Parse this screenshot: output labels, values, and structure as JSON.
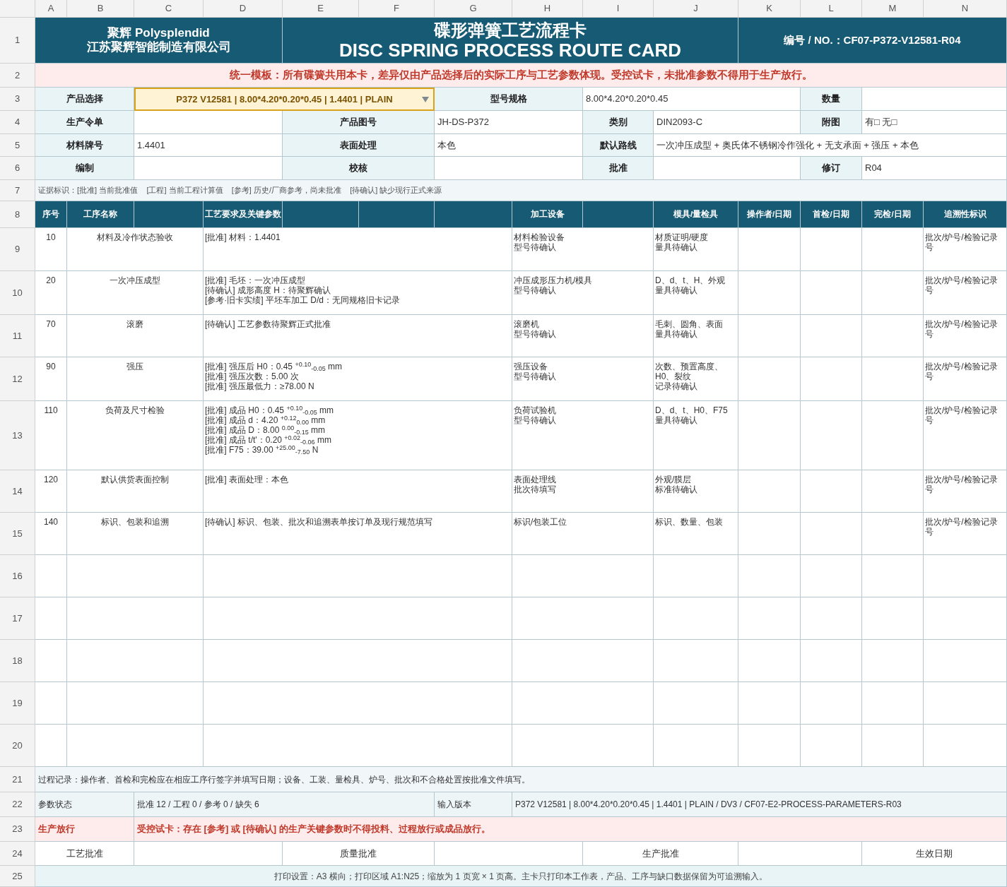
{
  "column_letters": [
    "A",
    "B",
    "C",
    "D",
    "E",
    "F",
    "G",
    "H",
    "I",
    "J",
    "K",
    "L",
    "M",
    "N"
  ],
  "row_numbers": [
    "1",
    "2",
    "3",
    "4",
    "5",
    "6",
    "7",
    "8",
    "9",
    "10",
    "11",
    "12",
    "13",
    "14",
    "15",
    "16",
    "17",
    "18",
    "19",
    "20",
    "21",
    "22",
    "23",
    "24",
    "25"
  ],
  "header": {
    "company": "聚辉 Polysplendid",
    "company_cn": "江苏聚辉智能制造有限公司",
    "title_cn": "碟形弹簧工艺流程卡",
    "title_en": "DISC SPRING PROCESS ROUTE CARD",
    "doc_no": "编号 / NO.：CF07-P372-V12581-R04"
  },
  "notice": "统一模板：所有碟簧共用本卡，差异仅由产品选择后的实际工序与工艺参数体现。受控试卡，未批准参数不得用于生产放行。",
  "product_select": {
    "label": "产品选择",
    "value": "P372 V12581 | 8.00*4.20*0.20*0.45 | 1.4401 | PLAIN"
  },
  "fields": [
    {
      "label": "型号规格",
      "value": "8.00*4.20*0.20*0.45"
    },
    {
      "label": "数量"
    },
    {
      "label": "生产令单"
    },
    {
      "label": "产品图号",
      "value": "JH-DS-P372"
    },
    {
      "label": "类别",
      "value": "DIN2093-C"
    },
    {
      "label": "附图",
      "value": "有□  无□"
    },
    {
      "label": "材料牌号",
      "value": "1.4401"
    },
    {
      "label": "表面处理",
      "value": "本色"
    },
    {
      "label": "默认路线",
      "value": "一次冲压成型 + 奥氏体不锈钢冷作强化 + 无支承面 + 强压 + 本色"
    },
    {
      "label": "编制"
    },
    {
      "label": "校核"
    },
    {
      "label": "批准"
    },
    {
      "label": "修订",
      "value": "R04"
    }
  ],
  "legend": "证据标识：[批准] 当前批准值    [工程] 当前工程计算值    [参考] 历史/厂商参考，尚未批准    [待确认] 缺少现行正式来源",
  "table": {
    "columns": [
      "序号",
      "工序名称",
      "工艺要求及关键参数",
      "加工设备",
      "模具/量检具",
      "操作者/日期",
      "首检/日期",
      "完检/日期",
      "追溯性标识"
    ],
    "rows": [
      {
        "seq": "10",
        "name": "材料及冷作状态验收",
        "params": [
          "[批准] 材料：1.4401"
        ],
        "equipment": [
          "材料检验设备",
          "型号待确认"
        ],
        "tooling": [
          "材质证明/硬度",
          "量具待确认"
        ],
        "trace": "批次/炉号/检验记录号"
      },
      {
        "seq": "20",
        "name": "一次冲压成型",
        "params": [
          "[批准] 毛坯：一次冲压成型",
          "[待确认] 成形高度 H：待聚辉确认",
          "[参考·旧卡实绩] 平坯车加工 D/d：无同规格旧卡记录"
        ],
        "equipment": [
          "冲压成形压力机/模具",
          "型号待确认"
        ],
        "tooling": [
          "D、d、t、H、外观",
          "量具待确认"
        ],
        "trace": "批次/炉号/检验记录号"
      },
      {
        "seq": "70",
        "name": "滚磨",
        "params": [
          "[待确认] 工艺参数待聚辉正式批准"
        ],
        "equipment": [
          "滚磨机",
          "型号待确认"
        ],
        "tooling": [
          "毛刺、圆角、表面",
          "量具待确认"
        ],
        "trace": "批次/炉号/检验记录号"
      },
      {
        "seq": "90",
        "name": "强压",
        "params": [
          "[批准] 强压后 H0：0.45 $^{+0.10}$$_{-0.05}$ mm",
          "[批准] 强压次数：5.00 次",
          "[批准] 强压最低力：≥78.00 N"
        ],
        "equipment": [
          "强压设备",
          "型号待确认"
        ],
        "tooling": [
          "次数、预置高度、H0、裂纹",
          "记录待确认"
        ],
        "trace": "批次/炉号/检验记录号"
      },
      {
        "seq": "110",
        "name": "负荷及尺寸检验",
        "params": [
          "[批准] 成品 H0：0.45 $^{+0.10}$$_{-0.05}$ mm",
          "[批准] 成品 d：4.20 $^{+0.12}$$_{0.00}$ mm",
          "[批准] 成品 D：8.00 $^{0.00}$$_{-0.15}$ mm",
          "[批准] 成品 t/t'：0.20 $^{+0.02}$$_{-0.06}$ mm",
          "[批准] F75：39.00 $^{+25.00}$$_{-7.50}$ N"
        ],
        "equipment": [
          "负荷试验机",
          "型号待确认"
        ],
        "tooling": [
          "D、d、t、H0、F75",
          "量具待确认"
        ],
        "trace": "批次/炉号/检验记录号"
      },
      {
        "seq": "120",
        "name": "默认供货表面控制",
        "params": [
          "[批准] 表面处理：本色"
        ],
        "equipment": [
          "表面处理线",
          "批次待填写"
        ],
        "tooling": [
          "外观/膜层",
          "标准待确认"
        ],
        "trace": "批次/炉号/检验记录号"
      },
      {
        "seq": "140",
        "name": "标识、包装和追溯",
        "params": [
          "[待确认] 标识、包装、批次和追溯表单按订单及现行规范填写"
        ],
        "equipment": [
          "标识/包装工位"
        ],
        "tooling": [
          "标识、数量、包装"
        ],
        "trace": "批次/炉号/检验记录号"
      }
    ]
  },
  "process_note": "过程记录：操作者、首检和完检应在相应工序行签字并填写日期；设备、工装、量检具、炉号、批次和不合格处置按批准文件填写。",
  "param_status": {
    "label": "参数状态",
    "value": "批准 12 / 工程 0 / 参考 0 / 缺失 6"
  },
  "input_version": {
    "label": "输入版本",
    "value": "P372 V12581 | 8.00*4.20*0.20*0.45 | 1.4401 | PLAIN / DV3 / CF07-E2-PROCESS-PARAMETERS-R03"
  },
  "release": {
    "label": "生产放行",
    "warning": "受控试卡：存在 [参考] 或 [待确认] 的生产关键参数时不得投料、过程放行或成品放行。"
  },
  "signatures": [
    "工艺批准",
    "质量批准",
    "生产批准",
    "生效日期"
  ],
  "print_note": "打印设置：A3 横向；打印区域 A1:N25；缩放为 1 页宽 × 1 页高。主卡只打印本工作表，产品、工序与缺口数据保留为可追溯输入。"
}
